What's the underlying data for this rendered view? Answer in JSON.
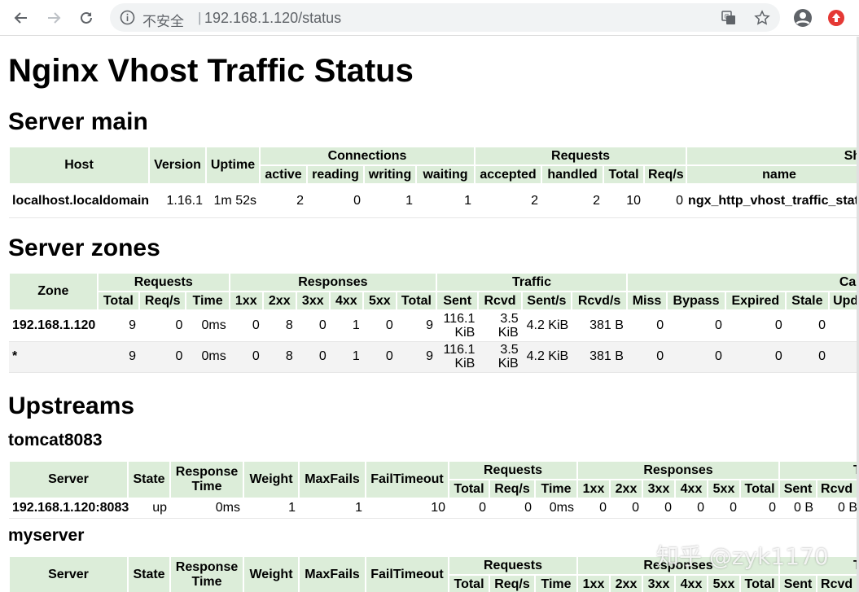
{
  "browser": {
    "insecure_label": "不安全",
    "separator": "|",
    "url": "192.168.1.120/status"
  },
  "page": {
    "title": "Nginx Vhost Traffic Status"
  },
  "server_main": {
    "heading": "Server main",
    "group_headers": [
      "Connections",
      "Requests",
      "Sha"
    ],
    "headers": {
      "host": "Host",
      "version": "Version",
      "uptime": "Uptime",
      "active": "active",
      "reading": "reading",
      "writing": "writing",
      "waiting": "waiting",
      "accepted": "accepted",
      "handled": "handled",
      "total": "Total",
      "reqs": "Req/s",
      "name": "name"
    },
    "row": {
      "host": "localhost.localdomain",
      "version": "1.16.1",
      "uptime": "1m 52s",
      "active": "2",
      "reading": "0",
      "writing": "1",
      "waiting": "1",
      "accepted": "2",
      "handled": "2",
      "total": "10",
      "reqs": "0",
      "name": "ngx_http_vhost_traffic_stat"
    }
  },
  "server_zones": {
    "heading": "Server zones",
    "group_headers": [
      "Requests",
      "Responses",
      "Traffic",
      "Cach"
    ],
    "headers": [
      "Zone",
      "Total",
      "Req/s",
      "Time",
      "1xx",
      "2xx",
      "3xx",
      "4xx",
      "5xx",
      "Total",
      "Sent",
      "Rcvd",
      "Sent/s",
      "Rcvd/s",
      "Miss",
      "Bypass",
      "Expired",
      "Stale",
      "Updatin"
    ],
    "rows": [
      {
        "zone": "192.168.1.120",
        "total": "9",
        "reqs": "0",
        "time": "0ms",
        "r1xx": "0",
        "r2xx": "8",
        "r3xx": "0",
        "r4xx": "1",
        "r5xx": "0",
        "rtotal": "9",
        "sent": "116.1 KiB",
        "rcvd": "3.5 KiB",
        "sents": "4.2 KiB",
        "rcvds": "381 B",
        "miss": "0",
        "bypass": "0",
        "expired": "0",
        "stale": "0"
      },
      {
        "zone": "*",
        "total": "9",
        "reqs": "0",
        "time": "0ms",
        "r1xx": "0",
        "r2xx": "8",
        "r3xx": "0",
        "r4xx": "1",
        "r5xx": "0",
        "rtotal": "9",
        "sent": "116.1 KiB",
        "rcvd": "3.5 KiB",
        "sents": "4.2 KiB",
        "rcvds": "381 B",
        "miss": "0",
        "bypass": "0",
        "expired": "0",
        "stale": "0"
      }
    ]
  },
  "upstreams": {
    "heading": "Upstreams",
    "group_headers": [
      "Requests",
      "Responses",
      "T"
    ],
    "headers": [
      "Server",
      "State",
      "Response Time",
      "Weight",
      "MaxFails",
      "FailTimeout",
      "Total",
      "Req/s",
      "Time",
      "1xx",
      "2xx",
      "3xx",
      "4xx",
      "5xx",
      "Total",
      "Sent",
      "Rcvd"
    ],
    "groups": [
      {
        "name": "tomcat8083",
        "row": {
          "server": "192.168.1.120:8083",
          "state": "up",
          "rtime": "0ms",
          "weight": "1",
          "maxfails": "1",
          "failtimeout": "10",
          "total": "0",
          "reqs": "0",
          "time": "0ms",
          "r1xx": "0",
          "r2xx": "0",
          "r3xx": "0",
          "r4xx": "0",
          "r5xx": "0",
          "rtotal": "0",
          "sent": "0 B",
          "rcvd": "0 B"
        }
      },
      {
        "name": "myserver"
      }
    ]
  },
  "watermark": "知乎 @zyk1170"
}
